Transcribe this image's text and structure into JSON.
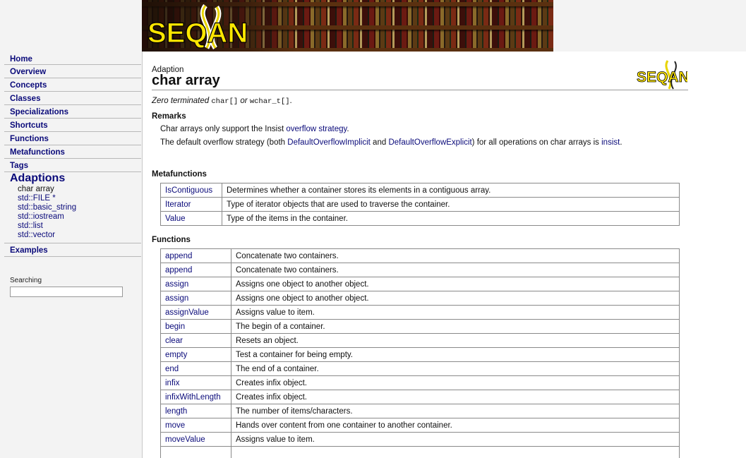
{
  "banner": {
    "logo_text": "SEQAN"
  },
  "sidebar": {
    "nav": [
      "Home",
      "Overview",
      "Concepts",
      "Classes",
      "Specializations",
      "Shortcuts",
      "Functions",
      "Metafunctions",
      "Tags"
    ],
    "section_title": "Adaptions",
    "section_items": [
      "char array",
      "std::FILE *",
      "std::basic_string",
      "std::iostream",
      "std::list",
      "std::vector"
    ],
    "after": "Examples",
    "search": {
      "label": "Searching",
      "value": ""
    }
  },
  "page": {
    "breadcrumb": "Adaption",
    "title": "char array",
    "corner_logo": "SEQAN",
    "summary": {
      "pre": "Zero terminated ",
      "code1": "char[]",
      "mid": " or ",
      "code2": "wchar_t[]",
      "post": "."
    }
  },
  "remarks": {
    "heading": "Remarks",
    "p1_pre": "Char arrays only support the Insist ",
    "p1_link": "overflow strategy",
    "p1_post": ".",
    "p2_pre": "The default overflow strategy (both ",
    "p2_link1": "DefaultOverflowImplicit",
    "p2_and": " and ",
    "p2_link2": "DefaultOverflowExplicit",
    "p2_mid": ") for all operations on char arrays is ",
    "p2_link3": "insist",
    "p2_post": "."
  },
  "metafunctions": {
    "heading": "Metafunctions",
    "rows": [
      {
        "name": "IsContiguous",
        "desc": "Determines whether a container stores its elements in a contiguous array."
      },
      {
        "name": "Iterator",
        "desc": "Type of iterator objects that are used to traverse the container."
      },
      {
        "name": "Value",
        "desc": "Type of the items in the container."
      }
    ]
  },
  "functions": {
    "heading": "Functions",
    "rows": [
      {
        "name": "append",
        "desc": "Concatenate two containers."
      },
      {
        "name": "append",
        "desc": "Concatenate two containers."
      },
      {
        "name": "assign",
        "desc": "Assigns one object to another object."
      },
      {
        "name": "assign",
        "desc": "Assigns one object to another object."
      },
      {
        "name": "assignValue",
        "desc": "Assigns value to item."
      },
      {
        "name": "begin",
        "desc": "The begin of a container."
      },
      {
        "name": "clear",
        "desc": "Resets an object."
      },
      {
        "name": "empty",
        "desc": "Test a container for being empty."
      },
      {
        "name": "end",
        "desc": "The end of a container."
      },
      {
        "name": "infix",
        "desc": "Creates infix object."
      },
      {
        "name": "infixWithLength",
        "desc": "Creates infix object."
      },
      {
        "name": "length",
        "desc": "The number of items/characters."
      },
      {
        "name": "move",
        "desc": "Hands over content from one container to another container."
      },
      {
        "name": "moveValue",
        "desc": "Assigns value to item."
      },
      {
        "name": "",
        "desc": ""
      }
    ]
  }
}
